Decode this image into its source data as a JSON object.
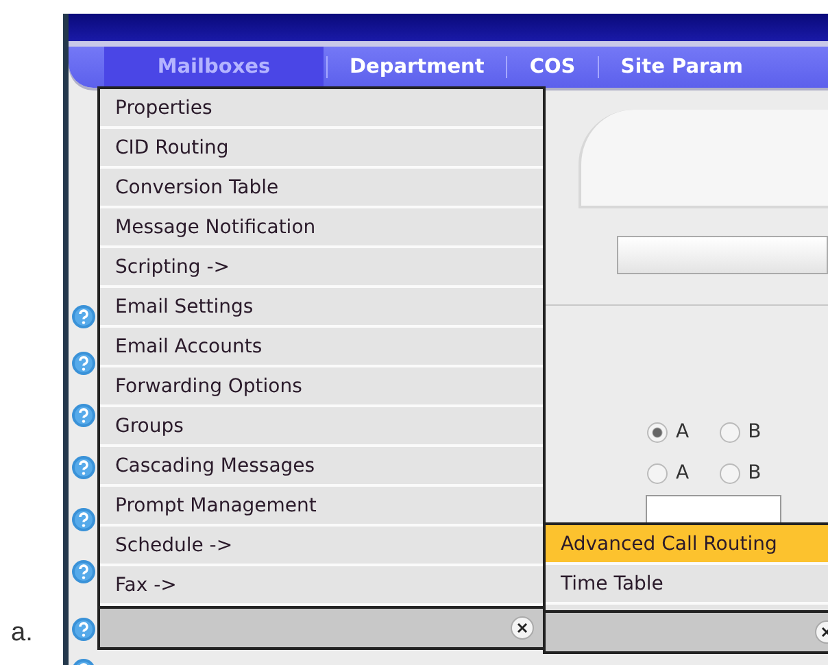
{
  "caption": "a.",
  "tabs": [
    {
      "label": "Mailboxes",
      "selected": true
    },
    {
      "label": "Department",
      "selected": false
    },
    {
      "label": "COS",
      "selected": false
    },
    {
      "label": "Site Param",
      "selected": false
    }
  ],
  "menu": {
    "items": [
      {
        "label": "Properties"
      },
      {
        "label": "CID Routing"
      },
      {
        "label": "Conversion Table"
      },
      {
        "label": "Message Notification"
      },
      {
        "label": "Scripting ->"
      },
      {
        "label": "Email Settings"
      },
      {
        "label": "Email Accounts"
      },
      {
        "label": "Forwarding Options"
      },
      {
        "label": "Groups"
      },
      {
        "label": "Cascading Messages"
      },
      {
        "label": "Prompt Management"
      },
      {
        "label": "Schedule ->"
      },
      {
        "label": "Fax ->"
      }
    ]
  },
  "submenu": {
    "items": [
      {
        "label": "Advanced Call Routing",
        "selected": true
      },
      {
        "label": "Time Table",
        "selected": false
      }
    ]
  },
  "radio_rows": [
    {
      "options": [
        {
          "label": "A",
          "selected": true
        },
        {
          "label": "B",
          "selected": false
        }
      ]
    },
    {
      "options": [
        {
          "label": "A",
          "selected": false
        },
        {
          "label": "B",
          "selected": false
        }
      ]
    }
  ]
}
